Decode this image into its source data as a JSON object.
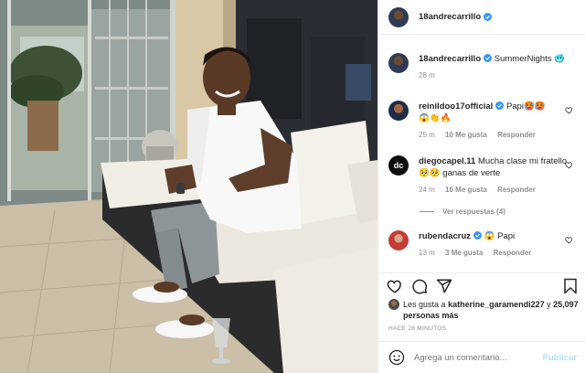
{
  "post": {
    "username": "18andrecarrillo",
    "caption": "SummerNights",
    "caption_emoji": "🥶",
    "caption_time": "28 m"
  },
  "comments": [
    {
      "username": "reinildoo17official",
      "text": "Papi🥵🥵",
      "text2": "😱👏🔥",
      "time": "25 m",
      "likes": "10 Me gusta",
      "reply": "Responder"
    },
    {
      "username": "diegocapel.11",
      "text": "Mucha clase mi fratello 🥺🥺 ganas de verte",
      "time": "24 m",
      "likes": "16 Me gusta",
      "reply": "Responder",
      "view_replies": "Ver respuestas (4)"
    },
    {
      "username": "rubendacruz",
      "text": "😱 Papi",
      "time": "13 m",
      "likes": "3 Me gusta",
      "reply": "Responder"
    }
  ],
  "likes_line": {
    "prefix": "Les gusta a",
    "user": "katherine_garamendi227",
    "mid": "y",
    "count": "25,097 personas más"
  },
  "time_ago": "HACE 28 MINUTOS",
  "add_comment": {
    "placeholder": "Agrega un comentario...",
    "publish": "Publicar"
  },
  "colors": {
    "verified": "#3897f0",
    "muted": "#8e8e8e",
    "publish_disabled": "#b2dffc"
  },
  "icons": {
    "like": "heart-icon",
    "comment": "comment-icon",
    "share": "paper-plane-icon",
    "save": "bookmark-icon",
    "emoji": "smiley-icon"
  }
}
